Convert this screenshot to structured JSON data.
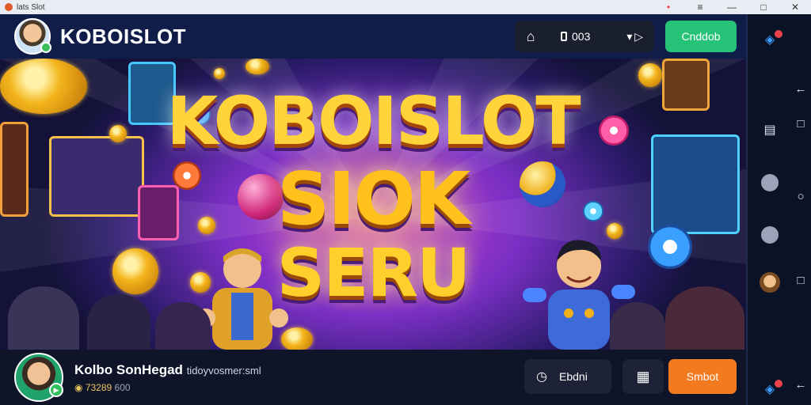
{
  "window": {
    "title": "lats Slot",
    "controls": [
      "•",
      "≡",
      "—",
      "□",
      "✕"
    ]
  },
  "header": {
    "brand": "KOBOISLOT",
    "tools": {
      "home_icon": "home-icon",
      "counter": "003",
      "sound_icon": "sound-icon"
    },
    "cta_label": "Cnddob",
    "cta_color": "#25c277"
  },
  "banner": {
    "line1": "KOBOISLOT",
    "line2": "SIOK",
    "line3": "SERU",
    "colors": {
      "gold": "#ffc21d",
      "magenta": "#c63bd3",
      "purple": "#7a2fc4"
    }
  },
  "bottombar": {
    "title": "Kolbo SonHegad",
    "subtitle": "tidoyvosmer:sml",
    "meta_value": "73289",
    "meta_extra": "600",
    "tools_label": "Ebdni",
    "tools_icon": "clock-icon",
    "icon_button": "chat-icon",
    "cta_label": "Smbot",
    "cta_color": "#f37a1f"
  },
  "sidebar": {
    "col_a": [
      "bell-icon",
      "document-icon",
      "user-icon",
      "user-icon",
      "avatar",
      "bell-icon"
    ],
    "col_b": [
      "back-arrow-icon",
      "square-icon",
      "circle-icon",
      "square-icon",
      "back-arrow-icon"
    ]
  }
}
